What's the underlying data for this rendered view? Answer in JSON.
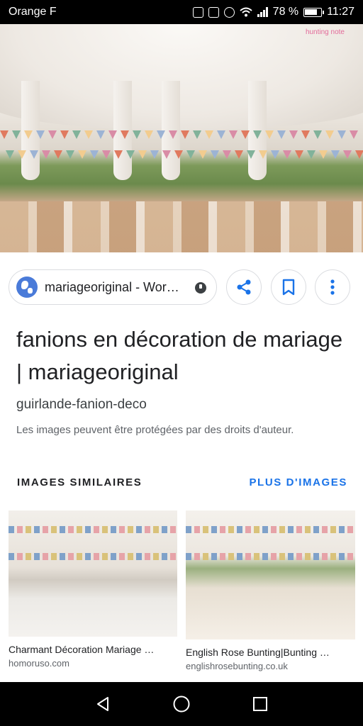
{
  "status_bar": {
    "carrier": "Orange F",
    "battery": "78 %",
    "time": "11:27"
  },
  "hero": {
    "watermark": "hunting note"
  },
  "source": {
    "label": "mariageoriginal - Wor…",
    "icons": {
      "site": "globe-icon",
      "info": "info-icon",
      "share": "share-icon",
      "save": "bookmark-icon",
      "more": "more-vert-icon"
    }
  },
  "result": {
    "title": "fanions en décoration de mariage | mariageoriginal",
    "subtitle": "guirlande-fanion-deco",
    "notice": "Les images peuvent être protégées par des droits d'auteur."
  },
  "similar": {
    "header": "IMAGES SIMILAIRES",
    "more_link": "PLUS D'IMAGES",
    "items": [
      {
        "title": "Charmant Décoration Mariage …",
        "domain": "homoruso.com"
      },
      {
        "title": "English Rose Bunting|Bunting …",
        "domain": "englishrosebunting.co.uk"
      }
    ]
  },
  "nav": {
    "icons": [
      "back-icon",
      "home-icon",
      "recents-icon"
    ]
  },
  "colors": {
    "accent": "#1a73e8",
    "text": "#202124",
    "muted": "#5f6368"
  }
}
